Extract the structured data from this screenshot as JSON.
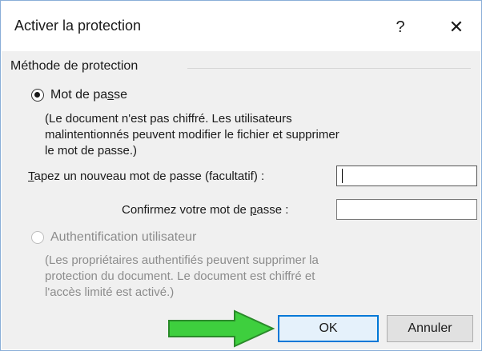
{
  "window": {
    "title": "Activer la protection",
    "help_label": "?",
    "close_label": "✕"
  },
  "group": {
    "label": "Méthode de protection"
  },
  "password_option": {
    "label_before": "Mot de pa",
    "label_underlined": "s",
    "label_after": "se",
    "selected": true,
    "description_lines": [
      "(Le document n'est pas chiffré. Les utilisateurs",
      "malintentionnés peuvent modifier le fichier et supprimer",
      "le mot de passe.)"
    ]
  },
  "new_password": {
    "label_underlined": "T",
    "label_rest": "apez un nouveau mot de passe (facultatif) :",
    "value": ""
  },
  "confirm_password": {
    "label_before": "Confirmez votre mot de ",
    "label_underlined": "p",
    "label_after": "asse :",
    "value": ""
  },
  "auth_option": {
    "label": "Authentification utilisateur",
    "selected": false,
    "enabled": false,
    "description_lines": [
      "(Les propriétaires authentifiés peuvent supprimer la",
      "protection du document. Le document est chiffré et",
      "l'accès limité est activé.)"
    ]
  },
  "buttons": {
    "ok": "OK",
    "cancel": "Annuler"
  },
  "colors": {
    "arrow_fill": "#3ecf3e",
    "arrow_stroke": "#2a8a2a",
    "accent": "#0078d7"
  }
}
